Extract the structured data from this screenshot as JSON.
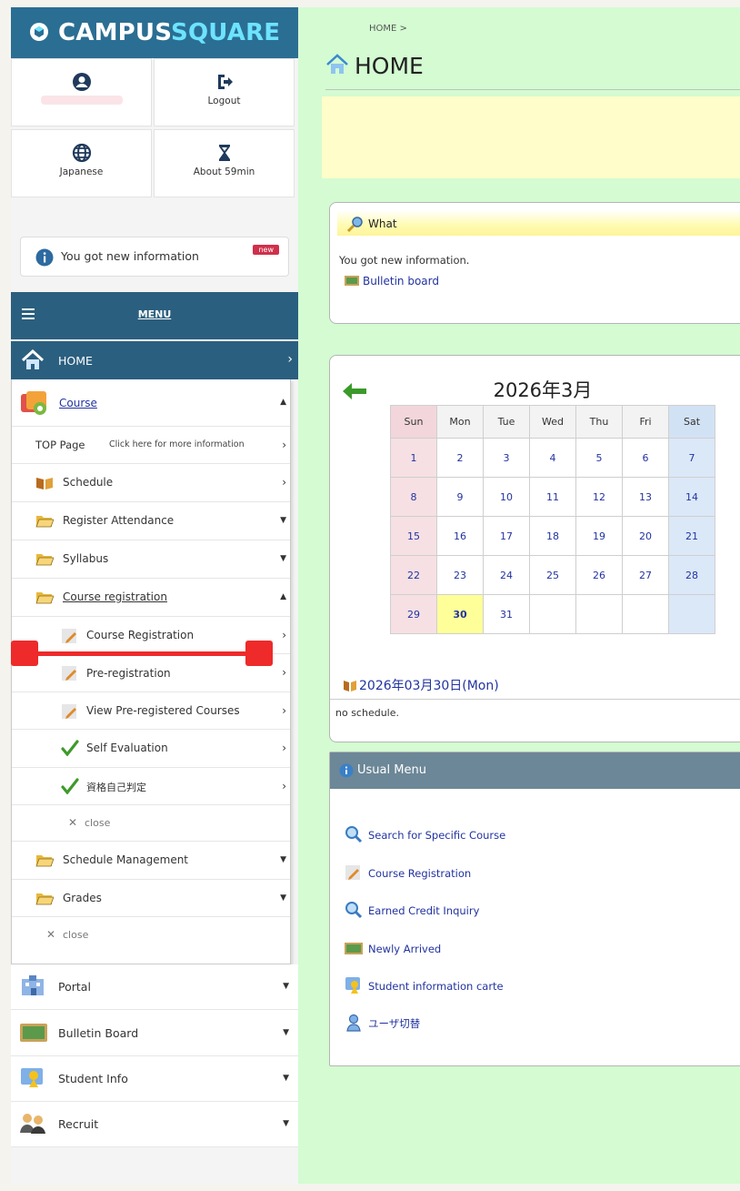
{
  "sidebar": {
    "brand": {
      "part1": "CAMPUS",
      "part2": "SQUARE"
    },
    "user_links": {
      "logout": "Logout",
      "language": "Japanese",
      "session": "About 59min"
    },
    "notice": {
      "text": "You got new information",
      "badge": "new"
    },
    "menu_label": "MENU",
    "home_label": "HOME",
    "course": {
      "label": "Course",
      "top_page": "TOP Page",
      "top_page_hint": "Click here for more information",
      "schedule": "Schedule",
      "register_attendance": "Register Attendance",
      "syllabus": "Syllabus",
      "course_registration": "Course registration",
      "sub": {
        "course_registration": "Course Registration",
        "pre_registration": "Pre-registration",
        "view_pre_registered": "View Pre-registered Courses",
        "self_evaluation": "Self Evaluation",
        "qualification": "資格自己判定",
        "close": "close"
      },
      "schedule_management": "Schedule Management",
      "grades": "Grades",
      "close": "close"
    },
    "lower": {
      "portal": "Portal",
      "bulletin_board": "Bulletin Board",
      "student_info": "Student Info",
      "recruit": "Recruit"
    }
  },
  "main": {
    "breadcrumb": "HOME >",
    "title": "HOME",
    "what": {
      "heading": "What",
      "message": "You got new information.",
      "link": "Bulletin board"
    },
    "calendar": {
      "title": "2026年3月",
      "weekdays": [
        "Sun",
        "Mon",
        "Tue",
        "Wed",
        "Thu",
        "Fri",
        "Sat"
      ],
      "weeks": [
        [
          "1",
          "2",
          "3",
          "4",
          "5",
          "6",
          "7"
        ],
        [
          "8",
          "9",
          "10",
          "11",
          "12",
          "13",
          "14"
        ],
        [
          "15",
          "16",
          "17",
          "18",
          "19",
          "20",
          "21"
        ],
        [
          "22",
          "23",
          "24",
          "25",
          "26",
          "27",
          "28"
        ],
        [
          "29",
          "30",
          "31",
          "",
          "",
          "",
          ""
        ]
      ],
      "today": "30",
      "date_label": "2026年03月30日(Mon)",
      "schedule_note": "no schedule."
    },
    "usual_menu": {
      "heading": "Usual Menu",
      "items": [
        "Search for Specific Course",
        "Course Registration",
        "Earned Credit Inquiry",
        "Newly Arrived",
        "Student information carte",
        "ユーザ切替"
      ]
    }
  },
  "colors": {
    "brand_blue": "#2b6e93",
    "menu_bar": "#2b5f7f",
    "main_bg": "#d4fbd2",
    "annotation_red": "#ee2a2a"
  }
}
